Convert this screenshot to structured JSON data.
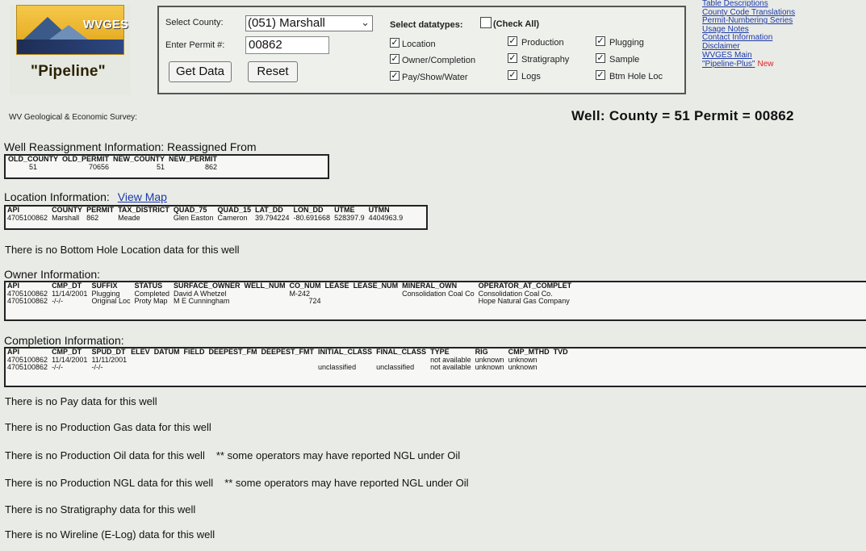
{
  "header": {
    "logo_text": "WVGES",
    "logo_title": "\"Pipeline\"",
    "form": {
      "county_label": "Select County:",
      "county_value": "(051) Marshall",
      "permit_label": "Enter Permit #:",
      "permit_value": "00862",
      "get_data_label": "Get Data",
      "reset_label": "Reset",
      "datatypes_label": "Select datatypes:",
      "check_all_label": "(Check All)",
      "check_all_checked": false,
      "datatypes": [
        {
          "label": "Location",
          "checked": true
        },
        {
          "label": "Production",
          "checked": true
        },
        {
          "label": "Plugging",
          "checked": true
        },
        {
          "label": "Owner/Completion",
          "checked": true
        },
        {
          "label": "Stratigraphy",
          "checked": true
        },
        {
          "label": "Sample",
          "checked": true
        },
        {
          "label": "Pay/Show/Water",
          "checked": true
        },
        {
          "label": "Logs",
          "checked": true
        },
        {
          "label": "Btm Hole Loc",
          "checked": true
        }
      ]
    },
    "links": [
      "Table Descriptions",
      "County Code Translations",
      "Permit-Numbering Series",
      "Usage Notes",
      "Contact Information",
      "Disclaimer",
      "WVGES Main",
      "\"Pipeline-Plus\""
    ],
    "new_label": "New"
  },
  "survey_label": "WV Geological & Economic Survey:",
  "well_heading": "Well:  County = 51 Permit = 00862",
  "reassign": {
    "title": "Well Reassignment Information: Reassigned From",
    "headers": [
      "OLD_COUNTY",
      "OLD_PERMIT",
      "NEW_COUNTY",
      "NEW_PERMIT"
    ],
    "row": [
      "51",
      "70656",
      "51",
      "862"
    ]
  },
  "location": {
    "title": "Location Information:",
    "view_map": "View Map",
    "headers": [
      "API",
      "COUNTY",
      "PERMIT",
      "TAX_DISTRICT",
      "QUAD_75",
      "QUAD_15",
      "LAT_DD",
      "LON_DD",
      "UTME",
      "UTMN"
    ],
    "row": [
      "4705100862",
      "Marshall",
      "862",
      "Meade",
      "Glen Easton",
      "Cameron",
      "39.794224",
      "-80.691668",
      "528397.9",
      "4404963.9"
    ]
  },
  "no_bottom_hole": "There is no Bottom Hole Location data for this well",
  "owner": {
    "title": "Owner Information:",
    "headers": [
      "API",
      "CMP_DT",
      "SUFFIX",
      "STATUS",
      "SURFACE_OWNER",
      "WELL_NUM",
      "CO_NUM",
      "LEASE",
      "LEASE_NUM",
      "MINERAL_OWN",
      "OPERATOR_AT_COMPLET"
    ],
    "rows": [
      [
        "4705100862",
        "11/14/2001",
        "Plugging",
        "Completed",
        "David A Whetzel",
        "",
        "M-242",
        "",
        "",
        "Consolidation Coal Co",
        "Consolidation Coal Co."
      ],
      [
        "4705100862",
        "-/-/-",
        "Original Loc",
        "Proty Map",
        "M E Cunningham",
        "",
        "724",
        "",
        "",
        "",
        "Hope Natural Gas Company"
      ]
    ]
  },
  "completion": {
    "title": "Completion Information:",
    "headers": [
      "API",
      "CMP_DT",
      "SPUD_DT",
      "ELEV",
      "DATUM",
      "FIELD",
      "DEEPEST_FM",
      "DEEPEST_FMT",
      "INITIAL_CLASS",
      "FINAL_CLASS",
      "TYPE",
      "RIG",
      "CMP_MTHD",
      "TVD"
    ],
    "rows": [
      [
        "4705100862",
        "11/14/2001",
        "11/11/2001",
        "",
        "",
        "",
        "",
        "",
        "",
        "",
        "not available",
        "unknown",
        "unknown",
        ""
      ],
      [
        "4705100862",
        "-/-/-",
        "-/-/-",
        "",
        "",
        "",
        "",
        "",
        "unclassified",
        "unclassified",
        "not available",
        "unknown",
        "unknown",
        ""
      ]
    ]
  },
  "messages": [
    {
      "text": "There is no Pay data for this well",
      "note": ""
    },
    {
      "text": "There is no Production Gas data for this well",
      "note": ""
    },
    {
      "text": "There is no Production Oil data for this well",
      "note": "** some operators may have reported NGL under Oil"
    },
    {
      "text": "There is no Production NGL data for this well",
      "note": "** some operators may have reported NGL under Oil"
    },
    {
      "text": "There is no Stratigraphy data for this well",
      "note": ""
    },
    {
      "text": "There is no Wireline (E-Log) data for this well",
      "note": ""
    }
  ]
}
